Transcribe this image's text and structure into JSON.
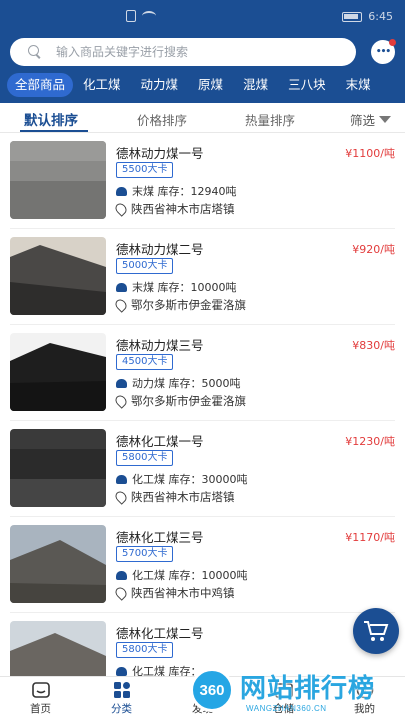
{
  "status_bar": {
    "time": "6:45"
  },
  "search": {
    "placeholder": "输入商品关键字进行搜索"
  },
  "categories": [
    "全部商品",
    "化工煤",
    "动力煤",
    "原煤",
    "混煤",
    "三八块",
    "末煤"
  ],
  "sort": {
    "default": "默认排序",
    "price": "价格排序",
    "hot": "热量排序",
    "filter": "筛选"
  },
  "products": [
    {
      "name": "德林动力煤一号",
      "price": "¥1100/吨",
      "kcal": "5500大卡",
      "stock": "末煤 库存：12940吨",
      "location": "陕西省神木市店塔镇"
    },
    {
      "name": "德林动力煤二号",
      "price": "¥920/吨",
      "kcal": "5000大卡",
      "stock": "末煤 库存：10000吨",
      "location": "鄂尔多斯市伊金霍洛旗"
    },
    {
      "name": "德林动力煤三号",
      "price": "¥830/吨",
      "kcal": "4500大卡",
      "stock": "动力煤 库存：5000吨",
      "location": "鄂尔多斯市伊金霍洛旗"
    },
    {
      "name": "德林化工煤一号",
      "price": "¥1230/吨",
      "kcal": "5800大卡",
      "stock": "化工煤 库存：30000吨",
      "location": "陕西省神木市店塔镇"
    },
    {
      "name": "德林化工煤三号",
      "price": "¥1170/吨",
      "kcal": "5700大卡",
      "stock": "化工煤 库存：10000吨",
      "location": "陕西省神木市中鸡镇"
    },
    {
      "name": "德林化工煤二号",
      "price": "¥",
      "kcal": "5800大卡",
      "stock": "化工煤 库存：",
      "location": ""
    }
  ],
  "tabs": [
    "首页",
    "分类",
    "发现",
    "仓储",
    "我的"
  ],
  "watermark": {
    "badge": "360",
    "title": "网站排行榜",
    "subtitle": "WANGZHAN360.CN"
  },
  "colors": {
    "brand": "#1b4e93",
    "price": "#e23c3c",
    "tag": "#2f6ad0"
  }
}
